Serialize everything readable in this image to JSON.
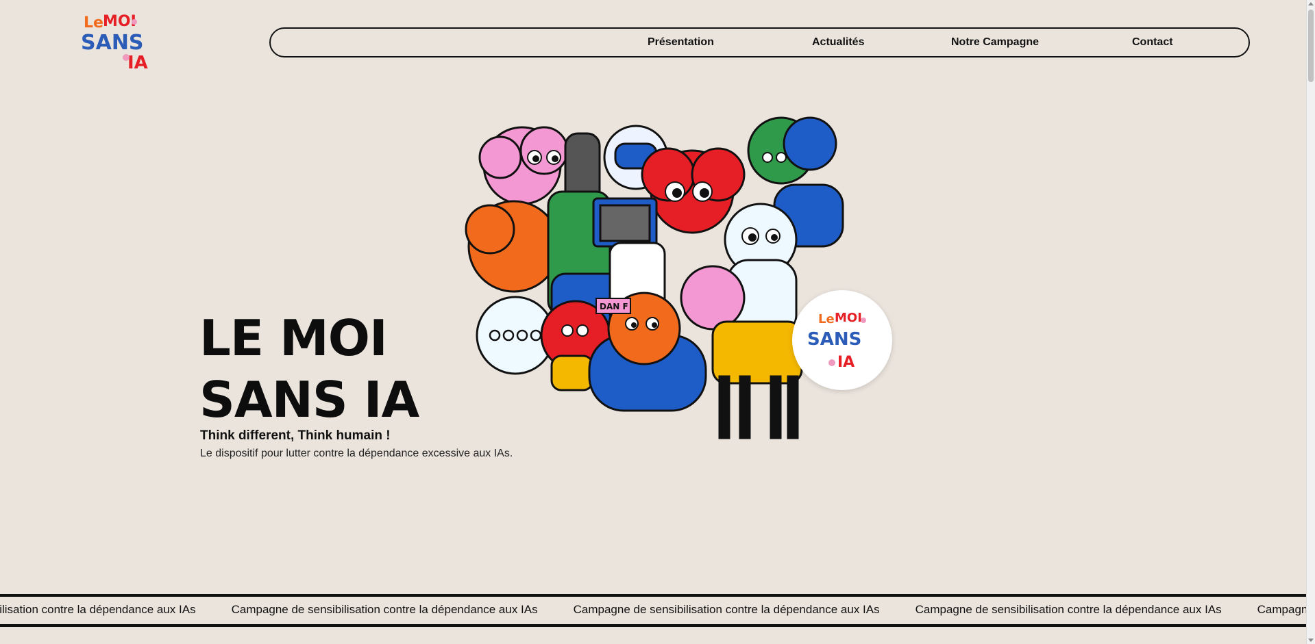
{
  "header": {
    "logo_text": [
      "Le",
      "MOI",
      "SANS",
      "IA"
    ],
    "nav": [
      {
        "label": "Présentation"
      },
      {
        "label": "Actualités"
      },
      {
        "label": "Notre Campagne"
      },
      {
        "label": "Contact"
      }
    ]
  },
  "hero": {
    "title_line1": "LE MOI",
    "title_line2": "SANS IA",
    "tagline": "Think different, Think humain !",
    "subtitle": "Le dispositif pour lutter contre la dépendance excessive aux IAs.",
    "illustration_icon": "cartoon-crowd-illustration",
    "illustration_text": [
      "DAN F"
    ],
    "badge_icon": "le-moi-sans-ia-logo-icon"
  },
  "marquee": {
    "items": [
      "ibilisation contre la dépendance aux IAs",
      "Campagne de sensibilisation contre la dépendance aux IAs",
      "Campagne de sensibilisation contre la dépendance aux IAs",
      "Campagne de sensibilisation contre la dépendance aux IAs",
      "Campagne d"
    ]
  },
  "colors": {
    "background": "#ebe4dd",
    "text": "#111111",
    "logo_orange": "#f26a1b",
    "logo_red": "#e61e25",
    "logo_blue": "#2b5cb8",
    "logo_pink": "#f19ac0",
    "logo_yellow": "#f5b800",
    "logo_green": "#2e9a4a"
  }
}
